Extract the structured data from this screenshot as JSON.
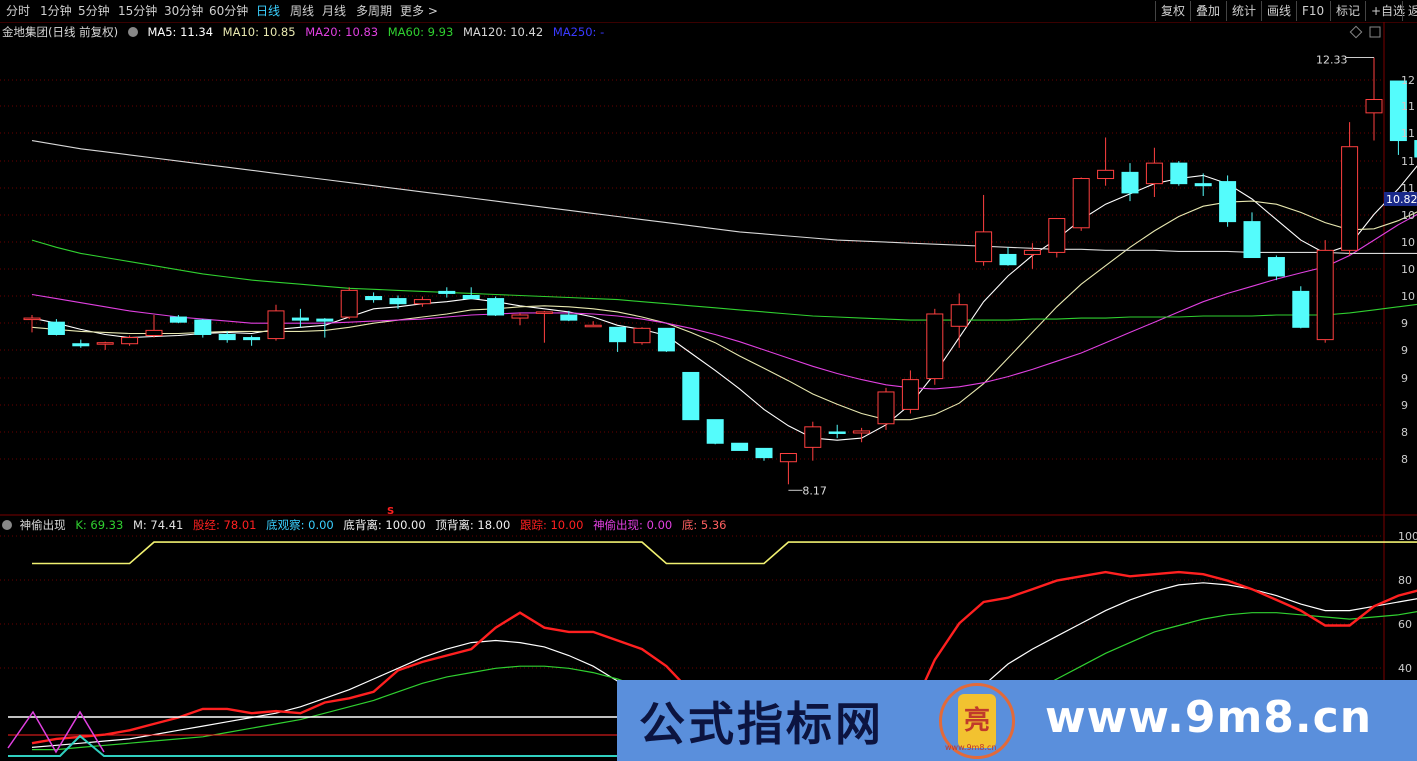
{
  "toolbar": {
    "tabs": [
      {
        "label": "分时",
        "active": false
      },
      {
        "label": "1分钟",
        "active": false
      },
      {
        "label": "5分钟",
        "active": false
      },
      {
        "label": "15分钟",
        "active": false
      },
      {
        "label": "30分钟",
        "active": false
      },
      {
        "label": "60分钟",
        "active": false
      },
      {
        "label": "日线",
        "active": true
      },
      {
        "label": "周线",
        "active": false
      },
      {
        "label": "月线",
        "active": false
      },
      {
        "label": "多周期",
        "active": false
      },
      {
        "label": "更多 >",
        "active": false
      }
    ],
    "right_buttons": [
      "复权",
      "叠加",
      "统计",
      "画线",
      "F10",
      "标记",
      "+自选",
      "返"
    ]
  },
  "main_legend": {
    "title": "金地集团(日线 前复权)",
    "ma5": "MA5: 11.34",
    "ma10": "MA10: 10.85",
    "ma20": "MA20: 10.83",
    "ma60": "MA60: 9.93",
    "ma120": "MA120: 10.42",
    "ma250": "MA250: -"
  },
  "sub_legend": {
    "title": "神偷出现",
    "k": "K: 69.33",
    "m": "M: 74.41",
    "gujing": "股经: 78.01",
    "diguancha": "底观察: 0.00",
    "dibeili": "底背离: 100.00",
    "dingbeili": "顶背离: 18.00",
    "genzong": "跟踪: 10.00",
    "shentou": "神偷出现: 0.00",
    "di": "底: 5.36"
  },
  "annotations": {
    "high_label": "12.33",
    "low_label": "8.17",
    "marker": "S",
    "price_tag": "10.82"
  },
  "watermark": {
    "cn": "公式指标网",
    "url": "www.9m8.cn",
    "logo_char": "亮",
    "logo_foot": "www.9m8.cn"
  },
  "colors": {
    "up": "#ff4040",
    "down": "#54fcfc",
    "ma5": "#ffffff",
    "ma10": "#e8e8b0",
    "ma20": "#e040e0",
    "ma60": "#30d030",
    "ma120": "#d8d8d8",
    "k_line": "#ffffff",
    "m_line": "#30d030",
    "gujing_line": "#ff2020",
    "top_step": "#f0f070"
  },
  "chart_data": [
    {
      "type": "candlestick",
      "title": "金地集团(日线 前复权)",
      "y_ticks": [
        "12",
        "11",
        "11",
        "11",
        "11",
        "10",
        "10",
        "10",
        "10",
        "9",
        "9",
        "9",
        "9",
        "8",
        "8"
      ],
      "ylim": [
        7.9,
        12.5
      ],
      "candles": [
        {
          "o": 9.79,
          "h": 9.82,
          "l": 9.65,
          "c": 9.79
        },
        {
          "o": 9.75,
          "h": 9.78,
          "l": 9.62,
          "c": 9.63
        },
        {
          "o": 9.54,
          "h": 9.58,
          "l": 9.5,
          "c": 9.52
        },
        {
          "o": 9.54,
          "h": 9.56,
          "l": 9.48,
          "c": 9.55
        },
        {
          "o": 9.54,
          "h": 9.62,
          "l": 9.52,
          "c": 9.6
        },
        {
          "o": 9.62,
          "h": 9.82,
          "l": 9.6,
          "c": 9.67
        },
        {
          "o": 9.8,
          "h": 9.82,
          "l": 9.74,
          "c": 9.75
        },
        {
          "o": 9.77,
          "h": 9.78,
          "l": 9.6,
          "c": 9.63
        },
        {
          "o": 9.63,
          "h": 9.66,
          "l": 9.55,
          "c": 9.58
        },
        {
          "o": 9.6,
          "h": 9.62,
          "l": 9.52,
          "c": 9.58
        },
        {
          "o": 9.59,
          "h": 9.92,
          "l": 9.57,
          "c": 9.86
        },
        {
          "o": 9.79,
          "h": 9.88,
          "l": 9.7,
          "c": 9.77
        },
        {
          "o": 9.78,
          "h": 9.79,
          "l": 9.6,
          "c": 9.76
        },
        {
          "o": 9.8,
          "h": 10.09,
          "l": 9.78,
          "c": 10.06
        },
        {
          "o": 10.0,
          "h": 10.04,
          "l": 9.94,
          "c": 9.97
        },
        {
          "o": 9.98,
          "h": 10.01,
          "l": 9.88,
          "c": 9.93
        },
        {
          "o": 9.93,
          "h": 10.0,
          "l": 9.9,
          "c": 9.97
        },
        {
          "o": 10.05,
          "h": 10.09,
          "l": 9.99,
          "c": 10.03
        },
        {
          "o": 10.01,
          "h": 10.09,
          "l": 9.99,
          "c": 9.98
        },
        {
          "o": 9.98,
          "h": 10.0,
          "l": 9.81,
          "c": 9.82
        },
        {
          "o": 9.79,
          "h": 9.84,
          "l": 9.72,
          "c": 9.82
        },
        {
          "o": 9.84,
          "h": 9.86,
          "l": 9.55,
          "c": 9.85
        },
        {
          "o": 9.82,
          "h": 9.86,
          "l": 9.76,
          "c": 9.77
        },
        {
          "o": 9.71,
          "h": 9.76,
          "l": 9.71,
          "c": 9.72
        },
        {
          "o": 9.7,
          "h": 9.7,
          "l": 9.46,
          "c": 9.56
        },
        {
          "o": 9.55,
          "h": 9.7,
          "l": 9.53,
          "c": 9.69
        },
        {
          "o": 9.69,
          "h": 9.69,
          "l": 9.46,
          "c": 9.47
        },
        {
          "o": 9.26,
          "h": 9.26,
          "l": 8.8,
          "c": 8.8
        },
        {
          "o": 8.8,
          "h": 8.8,
          "l": 8.56,
          "c": 8.57
        },
        {
          "o": 8.57,
          "h": 8.57,
          "l": 8.51,
          "c": 8.5
        },
        {
          "o": 8.52,
          "h": 8.52,
          "l": 8.4,
          "c": 8.43
        },
        {
          "o": 8.39,
          "h": 8.46,
          "l": 8.17,
          "c": 8.47
        },
        {
          "o": 8.53,
          "h": 8.78,
          "l": 8.4,
          "c": 8.73
        },
        {
          "o": 8.68,
          "h": 8.75,
          "l": 8.62,
          "c": 8.67
        },
        {
          "o": 8.67,
          "h": 8.72,
          "l": 8.58,
          "c": 8.69
        },
        {
          "o": 8.76,
          "h": 9.11,
          "l": 8.7,
          "c": 9.07
        },
        {
          "o": 8.9,
          "h": 9.28,
          "l": 8.86,
          "c": 9.19
        },
        {
          "o": 9.2,
          "h": 9.88,
          "l": 9.14,
          "c": 9.83
        },
        {
          "o": 9.71,
          "h": 10.03,
          "l": 9.5,
          "c": 9.92
        },
        {
          "o": 10.34,
          "h": 10.99,
          "l": 10.3,
          "c": 10.63
        },
        {
          "o": 10.41,
          "h": 10.48,
          "l": 10.3,
          "c": 10.31
        },
        {
          "o": 10.41,
          "h": 10.52,
          "l": 10.27,
          "c": 10.45
        },
        {
          "o": 10.43,
          "h": 10.76,
          "l": 10.38,
          "c": 10.76
        },
        {
          "o": 10.67,
          "h": 11.16,
          "l": 10.64,
          "c": 11.15
        },
        {
          "o": 11.15,
          "h": 11.55,
          "l": 11.08,
          "c": 11.23
        },
        {
          "o": 11.21,
          "h": 11.3,
          "l": 10.93,
          "c": 11.01
        },
        {
          "o": 11.1,
          "h": 11.45,
          "l": 10.97,
          "c": 11.3
        },
        {
          "o": 11.3,
          "h": 11.32,
          "l": 11.08,
          "c": 11.1
        },
        {
          "o": 11.1,
          "h": 11.2,
          "l": 10.98,
          "c": 11.08
        },
        {
          "o": 11.12,
          "h": 11.18,
          "l": 10.68,
          "c": 10.73
        },
        {
          "o": 10.73,
          "h": 10.82,
          "l": 10.38,
          "c": 10.38
        },
        {
          "o": 10.38,
          "h": 10.4,
          "l": 10.16,
          "c": 10.2
        },
        {
          "o": 10.05,
          "h": 10.1,
          "l": 9.69,
          "c": 9.7
        },
        {
          "o": 9.58,
          "h": 10.55,
          "l": 9.55,
          "c": 10.45
        },
        {
          "o": 10.45,
          "h": 11.7,
          "l": 10.4,
          "c": 11.46
        },
        {
          "o": 11.79,
          "h": 12.33,
          "l": 11.52,
          "c": 11.92
        },
        {
          "o": 12.1,
          "h": 12.1,
          "l": 11.38,
          "c": 11.52
        },
        {
          "o": 11.52,
          "h": 11.6,
          "l": 11.29,
          "c": 11.36
        }
      ],
      "series": [
        {
          "name": "MA5",
          "values": [
            9.79,
            9.74,
            9.68,
            9.63,
            9.6,
            9.61,
            9.62,
            9.64,
            9.65,
            9.64,
            9.68,
            9.7,
            9.72,
            9.8,
            9.88,
            9.9,
            9.93,
            9.95,
            9.98,
            9.95,
            9.91,
            9.88,
            9.85,
            9.8,
            9.72,
            9.68,
            9.62,
            9.45,
            9.28,
            9.1,
            8.9,
            8.74,
            8.62,
            8.6,
            8.62,
            8.75,
            8.95,
            9.25,
            9.6,
            9.95,
            10.2,
            10.4,
            10.56,
            10.75,
            10.9,
            11.0,
            11.1,
            11.15,
            11.18,
            11.1,
            10.95,
            10.75,
            10.55,
            10.42,
            10.5,
            10.8,
            11.05,
            11.34
          ]
        },
        {
          "name": "MA10",
          "values": [
            9.7,
            9.68,
            9.66,
            9.65,
            9.64,
            9.64,
            9.64,
            9.65,
            9.66,
            9.66,
            9.66,
            9.66,
            9.67,
            9.7,
            9.74,
            9.77,
            9.8,
            9.83,
            9.87,
            9.88,
            9.9,
            9.91,
            9.9,
            9.88,
            9.85,
            9.8,
            9.74,
            9.65,
            9.55,
            9.42,
            9.3,
            9.18,
            9.05,
            8.95,
            8.86,
            8.8,
            8.8,
            8.85,
            8.96,
            9.15,
            9.4,
            9.65,
            9.9,
            10.12,
            10.3,
            10.48,
            10.64,
            10.78,
            10.88,
            10.92,
            10.93,
            10.9,
            10.82,
            10.72,
            10.65,
            10.66,
            10.74,
            10.85
          ]
        },
        {
          "name": "MA20",
          "values": [
            10.02,
            9.98,
            9.94,
            9.9,
            9.86,
            9.83,
            9.8,
            9.78,
            9.76,
            9.74,
            9.74,
            9.74,
            9.74,
            9.75,
            9.76,
            9.77,
            9.78,
            9.8,
            9.82,
            9.83,
            9.84,
            9.84,
            9.84,
            9.83,
            9.81,
            9.78,
            9.74,
            9.69,
            9.63,
            9.56,
            9.48,
            9.4,
            9.32,
            9.25,
            9.19,
            9.14,
            9.11,
            9.1,
            9.12,
            9.16,
            9.22,
            9.29,
            9.37,
            9.45,
            9.55,
            9.65,
            9.75,
            9.85,
            9.95,
            10.03,
            10.1,
            10.17,
            10.23,
            10.29,
            10.4,
            10.55,
            10.7,
            10.83
          ]
        },
        {
          "name": "MA60",
          "values": [
            10.55,
            10.48,
            10.42,
            10.38,
            10.34,
            10.3,
            10.26,
            10.22,
            10.19,
            10.16,
            10.14,
            10.12,
            10.1,
            10.08,
            10.07,
            10.06,
            10.05,
            10.04,
            10.03,
            10.02,
            10.01,
            10.0,
            9.99,
            9.98,
            9.97,
            9.95,
            9.93,
            9.91,
            9.89,
            9.87,
            9.85,
            9.83,
            9.81,
            9.8,
            9.79,
            9.78,
            9.77,
            9.77,
            9.77,
            9.77,
            9.77,
            9.78,
            9.78,
            9.79,
            9.79,
            9.8,
            9.8,
            9.8,
            9.81,
            9.81,
            9.81,
            9.82,
            9.82,
            9.82,
            9.84,
            9.87,
            9.9,
            9.93
          ]
        },
        {
          "name": "MA120",
          "values": [
            11.52,
            11.48,
            11.44,
            11.41,
            11.38,
            11.35,
            11.32,
            11.29,
            11.26,
            11.23,
            11.2,
            11.17,
            11.14,
            11.11,
            11.08,
            11.05,
            11.02,
            10.99,
            10.96,
            10.93,
            10.9,
            10.87,
            10.84,
            10.81,
            10.78,
            10.75,
            10.72,
            10.69,
            10.66,
            10.63,
            10.61,
            10.59,
            10.57,
            10.55,
            10.54,
            10.53,
            10.52,
            10.51,
            10.5,
            10.49,
            10.48,
            10.47,
            10.46,
            10.46,
            10.45,
            10.45,
            10.45,
            10.44,
            10.44,
            10.44,
            10.43,
            10.43,
            10.43,
            10.43,
            10.42,
            10.42,
            10.42,
            10.42
          ]
        }
      ]
    },
    {
      "type": "line",
      "title": "神偷出现",
      "y_ticks": [
        "100",
        "80",
        "60",
        "40"
      ],
      "ylim": [
        0,
        108
      ],
      "series": [
        {
          "name": "K",
          "values": [
            4,
            5,
            6,
            7,
            8,
            10,
            12,
            14,
            16,
            18,
            20,
            23,
            27,
            31,
            36,
            41,
            46,
            50,
            53,
            54,
            53,
            51,
            47,
            42,
            35,
            27,
            18,
            10,
            4,
            1,
            0,
            0,
            0,
            0,
            0,
            0,
            4,
            12,
            22,
            33,
            43,
            50,
            56,
            62,
            68,
            73,
            77,
            80,
            81,
            80,
            78,
            75,
            71,
            68,
            68,
            70,
            72,
            74,
            69.33
          ]
        },
        {
          "name": "M",
          "values": [
            3,
            3,
            4,
            5,
            6,
            7,
            8,
            9,
            11,
            13,
            15,
            17,
            20,
            23,
            26,
            30,
            34,
            37,
            39,
            41,
            42,
            42,
            41,
            39,
            36,
            32,
            27,
            22,
            16,
            10,
            5,
            2,
            0,
            0,
            0,
            0,
            1,
            4,
            9,
            16,
            23,
            30,
            36,
            42,
            48,
            53,
            58,
            61,
            64,
            66,
            67,
            67,
            66,
            65,
            64,
            65,
            66,
            68,
            74.41
          ]
        },
        {
          "name": "股经",
          "values": [
            6,
            8,
            9,
            10,
            12,
            15,
            18,
            22,
            22,
            20,
            21,
            20,
            25,
            27,
            30,
            40,
            44,
            47,
            50,
            60,
            67,
            60,
            58,
            58,
            54,
            50,
            42,
            30,
            18,
            8,
            2,
            0,
            0,
            0,
            0,
            2,
            20,
            45,
            62,
            72,
            74,
            78,
            82,
            84,
            86,
            84,
            85,
            86,
            85,
            82,
            78,
            73,
            68,
            61,
            61,
            70,
            75,
            78,
            78.01
          ]
        },
        {
          "name": "顶部阶梯",
          "values": [
            90,
            90,
            90,
            90,
            90,
            100,
            100,
            100,
            100,
            100,
            100,
            100,
            100,
            100,
            100,
            100,
            100,
            100,
            100,
            100,
            100,
            100,
            100,
            100,
            100,
            100,
            90,
            90,
            90,
            90,
            90,
            100,
            100,
            100,
            100,
            100,
            100,
            100,
            100,
            100,
            100,
            100,
            100,
            100,
            100,
            100,
            100,
            100,
            100,
            100,
            100,
            100,
            100,
            100,
            100,
            100,
            100,
            100,
            100
          ]
        }
      ]
    }
  ]
}
